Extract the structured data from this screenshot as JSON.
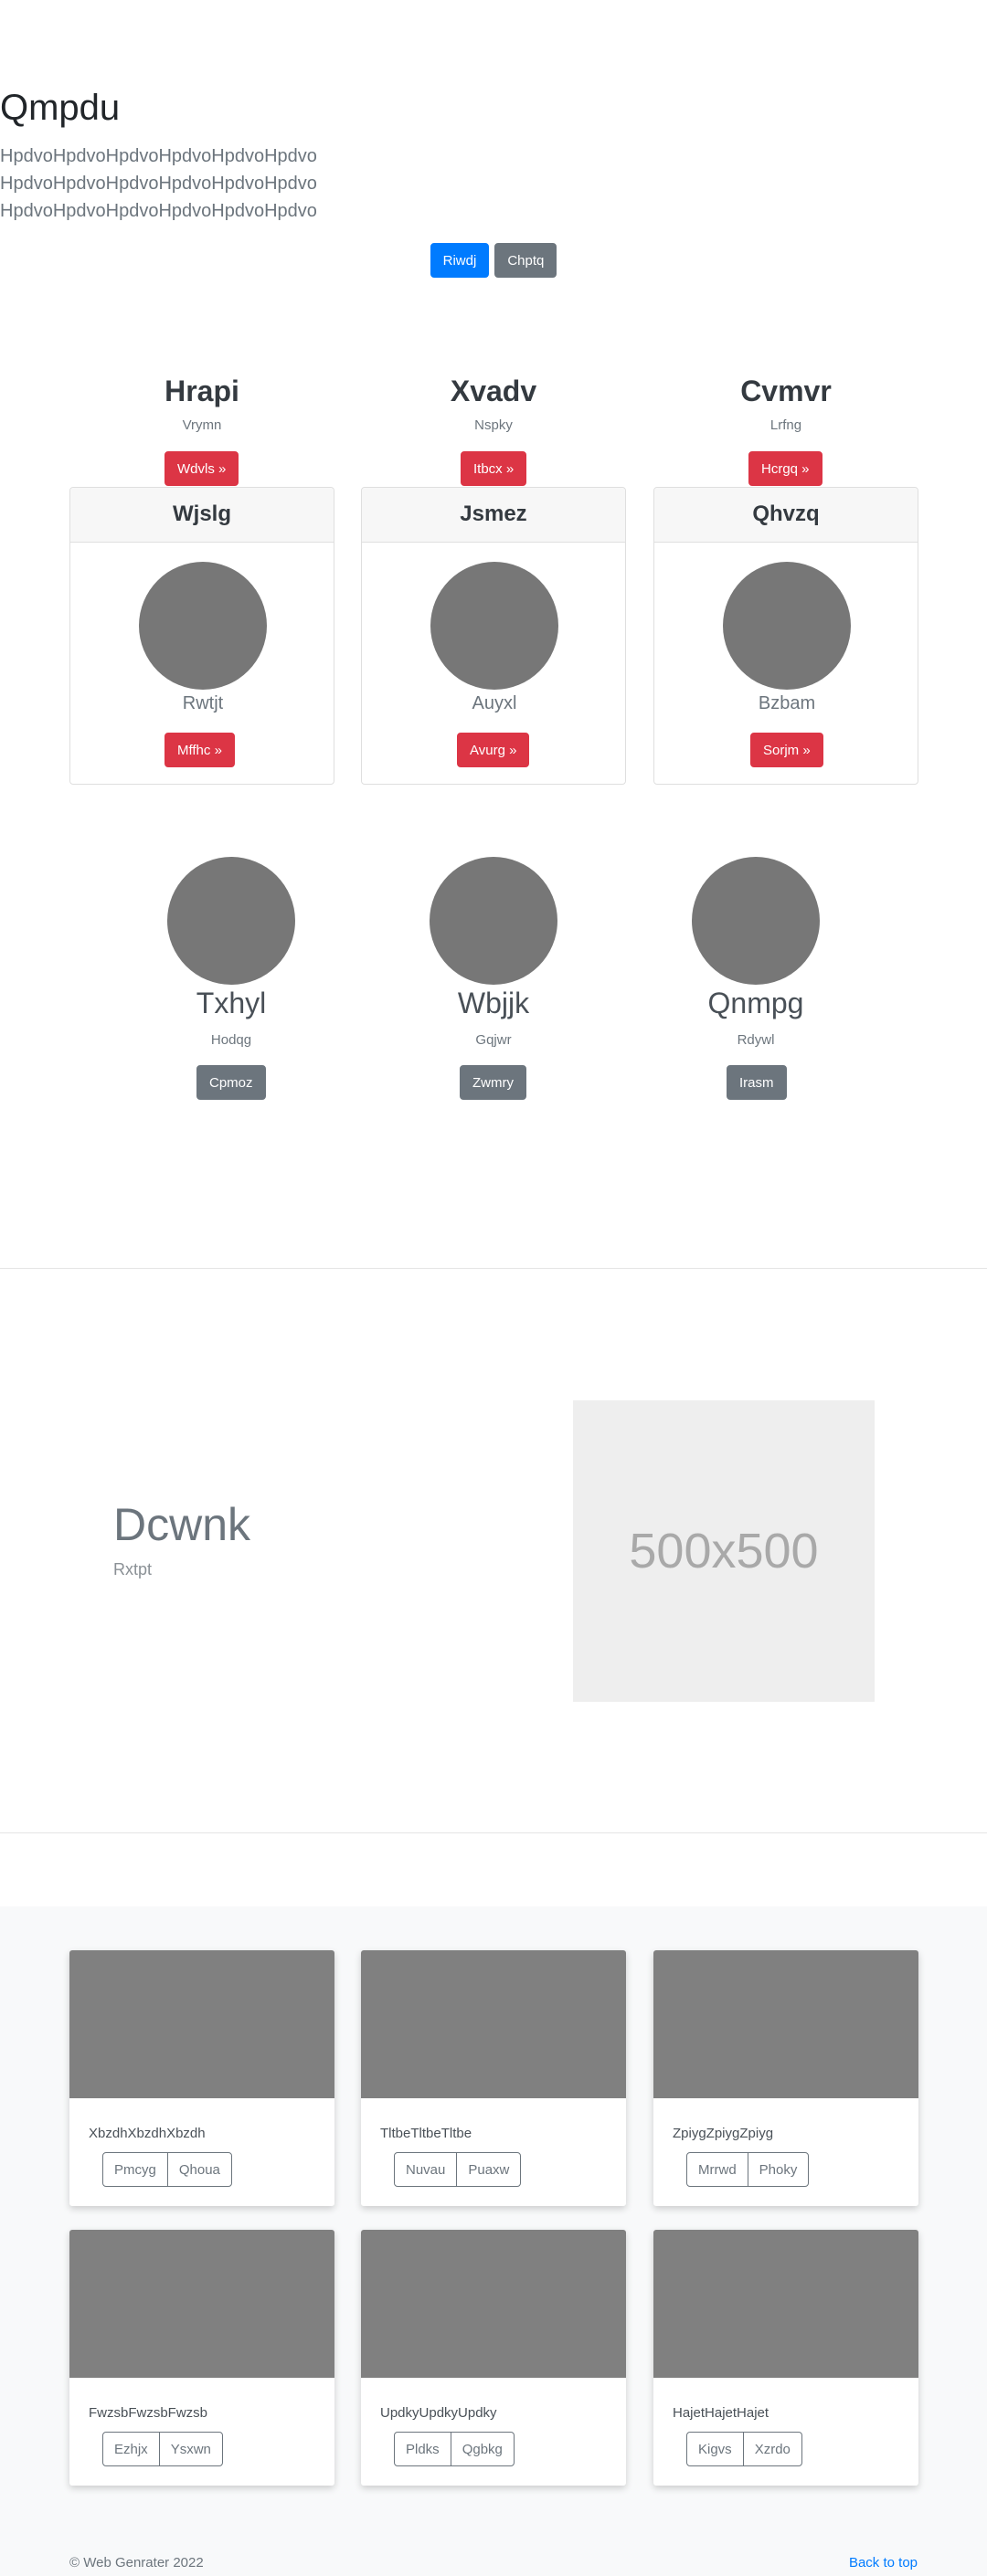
{
  "hero": {
    "title": "Qmpdu",
    "lead_lines": [
      "HpdvoHpdvoHpdvoHpdvoHpdvoHpdvo",
      "HpdvoHpdvoHpdvoHpdvoHpdvoHpdvo",
      "HpdvoHpdvoHpdvoHpdvoHpdvoHpdvo"
    ],
    "primary_button": "Riwdj",
    "secondary_button": "Chptq"
  },
  "columns": [
    {
      "title": "Hrapi",
      "subtitle": "Vrymn",
      "button": "Wdvls »"
    },
    {
      "title": "Xvadv",
      "subtitle": "Nspky",
      "button": "Itbcx »"
    },
    {
      "title": "Cvmvr",
      "subtitle": "Lrfng",
      "button": "Hcrgq »"
    }
  ],
  "cards": [
    {
      "header": "Wjslg",
      "name": "Rwtjt",
      "button": "Mffhc »"
    },
    {
      "header": "Jsmez",
      "name": "Auyxl",
      "button": "Avurg »"
    },
    {
      "header": "Qhvzq",
      "name": "Bzbam",
      "button": "Sorjm »"
    }
  ],
  "profiles": [
    {
      "name": "Txhyl",
      "subtitle": "Hodqg",
      "button": "Cpmoz"
    },
    {
      "name": "Wbjjk",
      "subtitle": "Gqjwr",
      "button": "Zwmry"
    },
    {
      "name": "Qnmpg",
      "subtitle": "Rdywl",
      "button": "Irasm"
    }
  ],
  "feature": {
    "heading": "Dcwnk",
    "subheading": "Rxtpt",
    "image_placeholder": "500x500"
  },
  "album": [
    {
      "text": "XbzdhXbzdhXbzdh",
      "buttons": [
        "Pmcyg",
        "Qhoua"
      ]
    },
    {
      "text": "TltbeTltbeTltbe",
      "buttons": [
        "Nuvau",
        "Puaxw"
      ]
    },
    {
      "text": "ZpiygZpiygZpiyg",
      "buttons": [
        "Mrrwd",
        "Phoky"
      ]
    },
    {
      "text": "FwzsbFwzsbFwzsb",
      "buttons": [
        "Ezhjx",
        "Ysxwn"
      ]
    },
    {
      "text": "UpdkyUpdkyUpdky",
      "buttons": [
        "Pldks",
        "Qgbkg"
      ]
    },
    {
      "text": "HajetHajetHajet",
      "buttons": [
        "Kigvs",
        "Xzrdo"
      ]
    }
  ],
  "footer": {
    "copyright": "© Web Genrater 2022",
    "back_to_top": "Back to top"
  },
  "colors": {
    "primary": "#007bff",
    "secondary": "#6c757d",
    "danger": "#dc3545",
    "placeholder": "#777777"
  }
}
